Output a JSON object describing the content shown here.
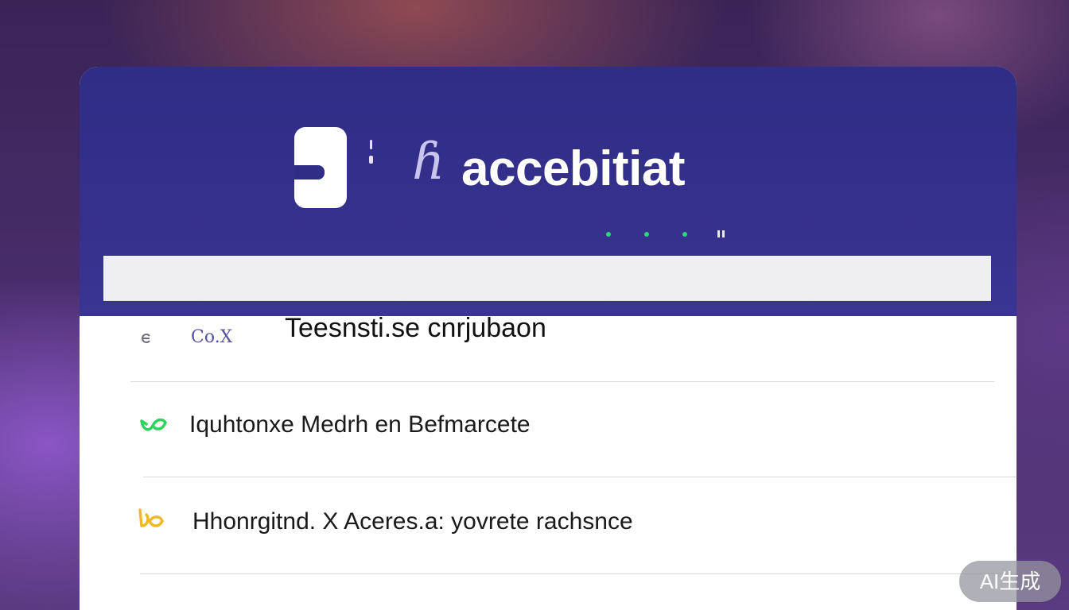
{
  "header": {
    "logo_script": "ɦ",
    "title": "accebitiat"
  },
  "rows": [
    {
      "search_label": "Co.X",
      "title": "Teesnsti.se cnrjubaon"
    },
    {
      "icon_name": "green-leaf-icon",
      "icon_color": "#2fd15f",
      "text": "Iquhtonxe Medrh en Befmarcete"
    },
    {
      "icon_name": "yellow-leaf-icon",
      "icon_color": "#f0b72a",
      "text": "Hhonrgitnd. X Aceres.a: yovrete rachsnce"
    }
  ],
  "colors": {
    "header_bg": "#2f2d86",
    "accent_green": "#2fd37b"
  },
  "watermark": "AI生成"
}
